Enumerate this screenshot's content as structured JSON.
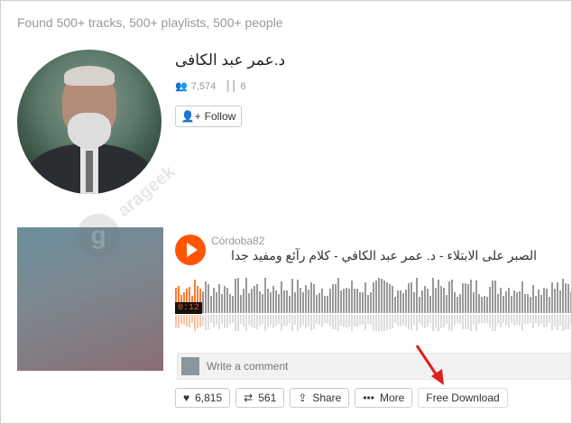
{
  "search": {
    "summary": "Found 500+ tracks, 500+ playlists, 500+ people"
  },
  "user": {
    "name": "د.عمر عبد الكافى",
    "followers": "7,574",
    "tracks": "6",
    "follow_label": "Follow"
  },
  "track": {
    "uploader": "Córdoba82",
    "title": "الصبر على الابتلاء - د. عمر عبد الكافي - كلام رآئع ومفيد جدا",
    "time": "0:12",
    "comment_placeholder": "Write a comment",
    "likes": "6,815",
    "reposts": "561",
    "share_label": "Share",
    "more_label": "More",
    "download_label": "Free Download"
  },
  "watermark": {
    "text": "arageek"
  },
  "colors": {
    "accent": "#ff5500",
    "arrow": "#e02020"
  },
  "icons": [
    "followers-icon",
    "tracks-icon",
    "follow-icon",
    "play-icon",
    "heart-icon",
    "repost-icon",
    "share-icon",
    "more-icon"
  ]
}
